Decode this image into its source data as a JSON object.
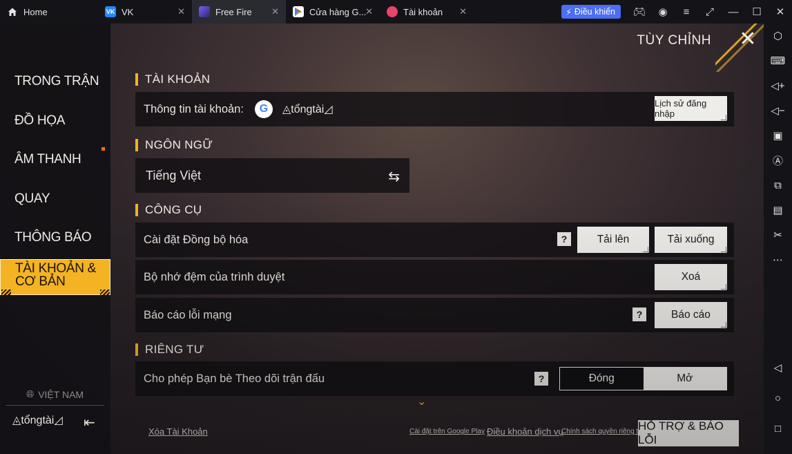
{
  "tabs": [
    {
      "label": "Home",
      "icon": "home-icon"
    },
    {
      "label": "VK",
      "icon": "vk-icon"
    },
    {
      "label": "Free Fire",
      "icon": "free-fire-icon"
    },
    {
      "label": "Cửa hàng G...",
      "icon": "play-store-icon"
    },
    {
      "label": "Tài khoản",
      "icon": "account-app-icon"
    }
  ],
  "titlebar": {
    "control_label": "Điều khiển"
  },
  "game": {
    "title": "TÙY CHỈNH",
    "nav": [
      {
        "label": "TRONG TRẬN"
      },
      {
        "label": "ĐỒ HỌA"
      },
      {
        "label": "ÂM THANH"
      },
      {
        "label": "QUAY"
      },
      {
        "label": "THÔNG BÁO"
      },
      {
        "label": "TÀI KHOẢN & CƠ BẢN"
      }
    ],
    "region": "VIỆT NAM",
    "logo_text": "tổngtài",
    "sections": {
      "account": {
        "title": "TÀI KHOẢN",
        "info_label": "Thông tin tài khoản:",
        "logo_text": "tổngtài",
        "login_history": "Lịch sử đăng nhập"
      },
      "language": {
        "title": "NGÔN NGỮ",
        "value": "Tiếng Việt"
      },
      "tools": {
        "title": "CÔNG CỤ",
        "sync_label": "Cài đặt Đồng bộ hóa",
        "upload": "Tải lên",
        "download": "Tải xuống",
        "cache_label": "Bộ nhớ đệm của trình duyệt",
        "clear": "Xoá",
        "network_label": "Báo cáo lỗi mạng",
        "report": "Báo cáo"
      },
      "privacy": {
        "title": "RIÊNG TƯ",
        "follow_label": "Cho phép Bạn bè Theo dõi trận đấu",
        "off": "Đóng",
        "on": "Mở"
      }
    },
    "help_glyph": "?",
    "footer": {
      "delete_account": "Xóa Tài Khoản",
      "google_play_settings": "Cài đặt trên Google Play",
      "terms": "Điều khoản dịch vụ",
      "privacy_policy": "Chính sách quyền riêng tư",
      "support": "HỖ TRỢ & BÁO LỖI"
    }
  },
  "colors": {
    "accent": "#f3b322",
    "control_blue": "#4b6ef5"
  }
}
